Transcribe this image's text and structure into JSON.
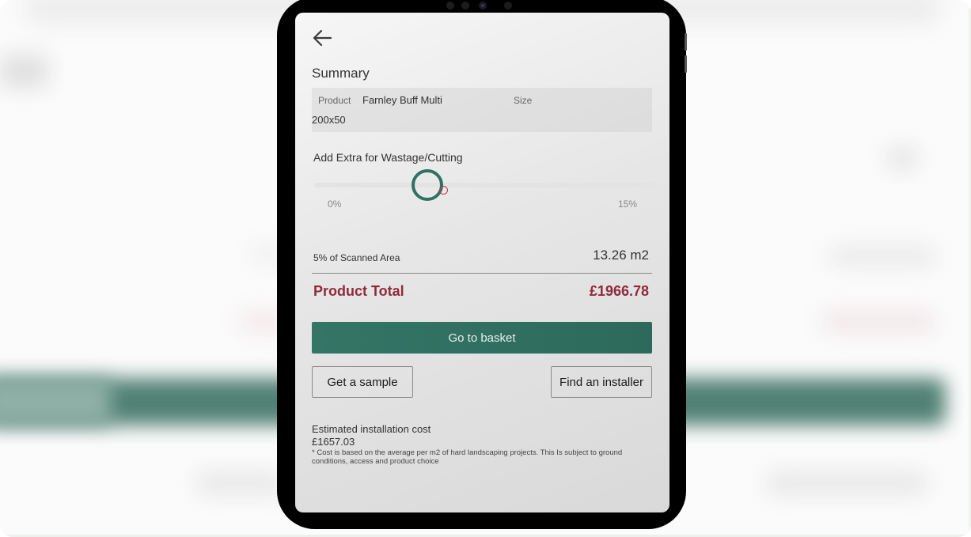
{
  "screen": {
    "back_icon": "arrow-left-icon",
    "title": "Summary",
    "summary": {
      "product_label": "Product",
      "product_value": "Farnley Buff Multi",
      "size_label": "Size",
      "size_value": "200x50"
    },
    "wastage": {
      "label": "Add Extra for Wastage/Cutting",
      "min_label": "0%",
      "max_label": "15%",
      "min": 0,
      "max": 15,
      "value": 5,
      "marker_value": 5.7
    },
    "area": {
      "label": "5% of Scanned Area",
      "value": "13.26 m2"
    },
    "total": {
      "label": "Product Total",
      "value": "£1966.78"
    },
    "buttons": {
      "basket": "Go to basket",
      "sample": "Get a sample",
      "installer": "Find an installer"
    },
    "installation": {
      "label": "Estimated installation cost",
      "value": "£1657.03",
      "note": "* Cost is based on the average per m2 of hard landscaping projects. This Is subject to ground conditions, access and product choice"
    }
  },
  "colors": {
    "accent_green": "#2e7262",
    "total_red": "#8f2a3c",
    "marker_red": "#c2334f"
  }
}
